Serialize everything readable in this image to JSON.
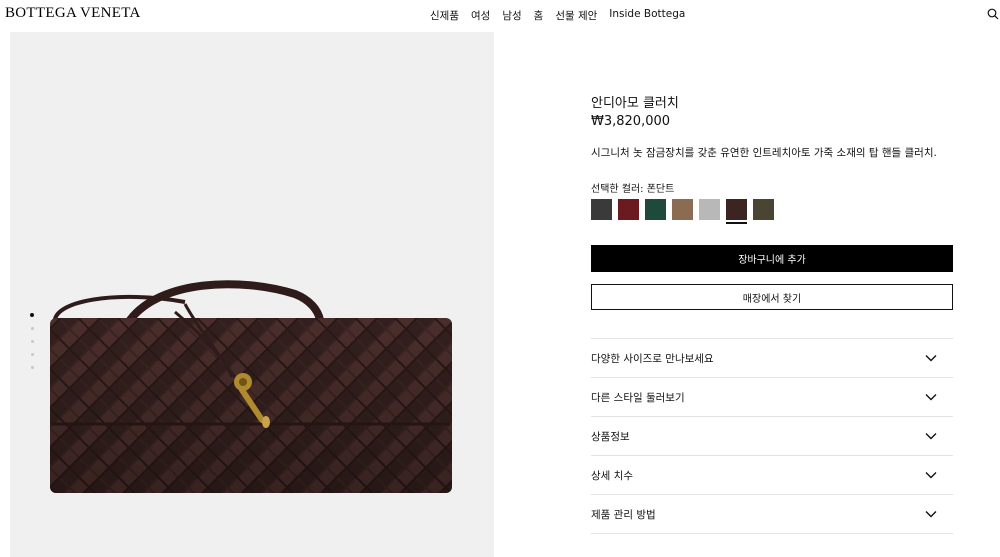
{
  "header": {
    "logo": "BOTTEGA VENETA",
    "nav": [
      "신제품",
      "여성",
      "남성",
      "홈",
      "선물 제안",
      "Inside Bottega"
    ],
    "search_icon": "search-icon"
  },
  "gallery": {
    "image_description_icon": "clutch-bag-image",
    "dot_count": 5,
    "active_dot": 0
  },
  "product": {
    "title": "안디아모 클러치",
    "price": "₩3,820,000",
    "description": "시그니처 놋 잠금장치를 갖춘 유연한 인트레치아토 가죽 소재의 탑 핸들 클러치.",
    "selected_color": "선택한 컬러: 폰단트",
    "swatches": [
      "#3a3a3a",
      "#6b1a1f",
      "#1f4a3a",
      "#8b6b52",
      "#b8b8b8",
      "#3b2422",
      "#4a4433"
    ],
    "selected_swatch": 5,
    "add_to_cart": "장바구니에 추가",
    "find_in_store": "매장에서 찾기"
  },
  "accordion": [
    "다양한 사이즈로 만나보세요",
    "다른 스타일 둘러보기",
    "상품정보",
    "상세 치수",
    "제품 관리 방법"
  ],
  "colors": {
    "accent": "#000000",
    "image_bg": "#f0f0f0",
    "leather": "#3b2422",
    "hardware": "#b08a2e"
  }
}
